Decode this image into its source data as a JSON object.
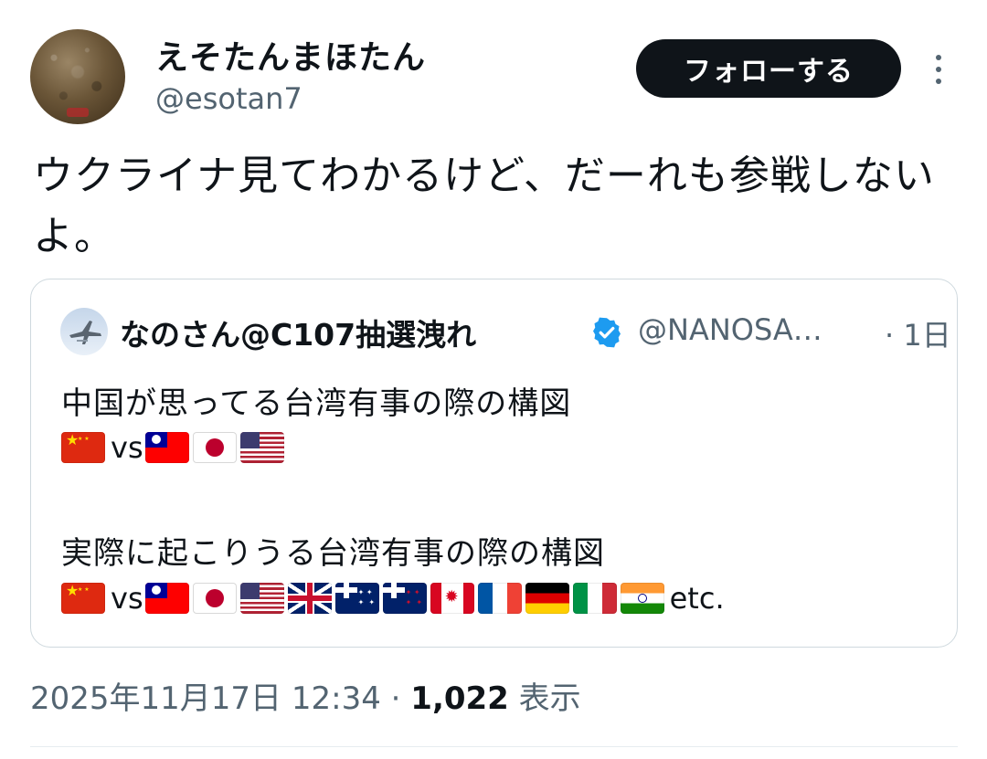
{
  "author": {
    "display_name": "えそたんまほたん",
    "handle": "@esotan7",
    "avatar_icon": "avatar-photo"
  },
  "actions": {
    "follow_label": "フォローする",
    "more_icon": "more-vertical-icon"
  },
  "tweet": {
    "text": "ウクライナ見てわかるけど、だーれも参戦しないよ。"
  },
  "quote": {
    "display_name": "なのさん@C107抽選洩れ",
    "handle": "@NANOSA…",
    "time": "· 1日",
    "verified_icon": "verified-badge-icon",
    "verified_color": "#1d9bf0",
    "line1": "中国が思ってる台湾有事の際の構図",
    "line2": "実際に起こりうる台湾有事の際の構図",
    "vs": "vs",
    "etc": "etc.",
    "flags_row1": [
      "china-flag-icon",
      "vs",
      "taiwan-flag-icon",
      "japan-flag-icon",
      "usa-flag-icon"
    ],
    "flags_row2": [
      "china-flag-icon",
      "vs",
      "taiwan-flag-icon",
      "japan-flag-icon",
      "usa-flag-icon",
      "uk-flag-icon",
      "australia-flag-icon",
      "new-zealand-flag-icon",
      "canada-flag-icon",
      "france-flag-icon",
      "germany-flag-icon",
      "italy-flag-icon",
      "india-flag-icon",
      "etc."
    ]
  },
  "meta": {
    "timestamp": "2025年11月17日 12:34",
    "separator": "·",
    "views_count": "1,022",
    "views_label": "表示"
  }
}
